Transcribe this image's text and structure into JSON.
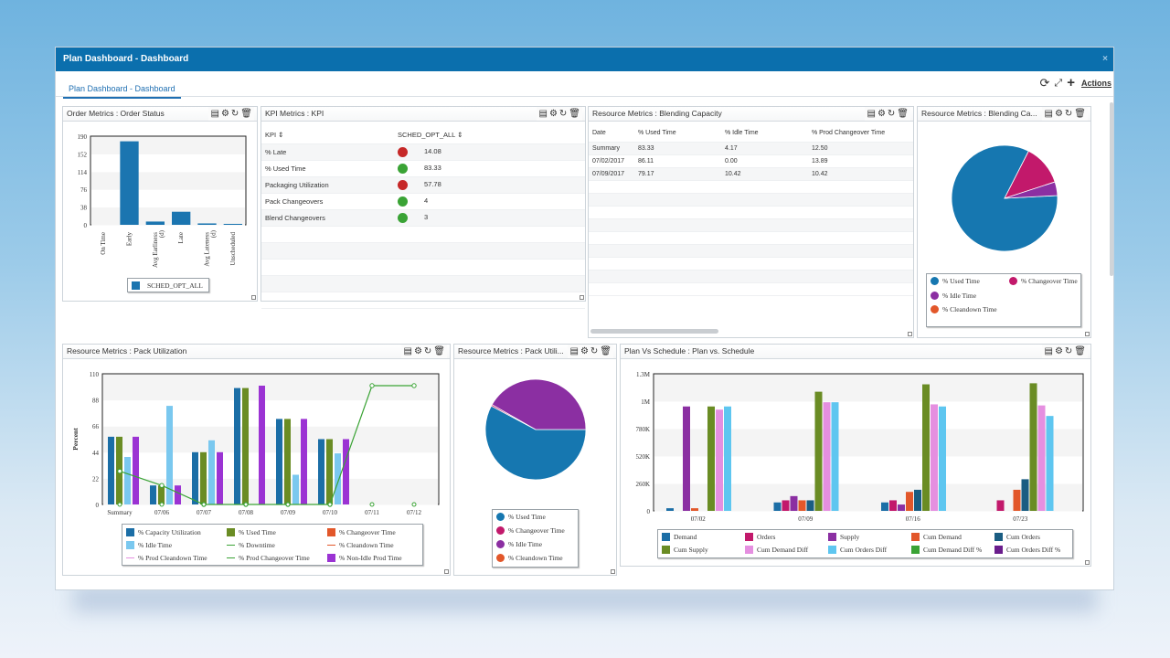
{
  "window": {
    "title": "Plan Dashboard - Dashboard",
    "tab": "Plan Dashboard - Dashboard",
    "actions_label": "Actions"
  },
  "panels": {
    "order": {
      "title": "Order Metrics : Order Status",
      "legend": "SCHED_OPT_ALL"
    },
    "kpi": {
      "title": "KPI Metrics : KPI",
      "col1": "KPI",
      "col2": "SCHED_OPT_ALL",
      "rows": [
        {
          "name": "% Late",
          "status": "red",
          "value": "14.08"
        },
        {
          "name": "% Used Time",
          "status": "green",
          "value": "83.33"
        },
        {
          "name": "Packaging Utilization",
          "status": "red",
          "value": "57.78"
        },
        {
          "name": "Pack Changeovers",
          "status": "green",
          "value": "4"
        },
        {
          "name": "Blend Changeovers",
          "status": "green",
          "value": "3"
        }
      ]
    },
    "resource": {
      "title": "Resource Metrics : Blending Capacity",
      "cols": [
        "Date",
        "% Used Time",
        "% Idle Time",
        "% Prod Changeover Time"
      ],
      "rows": [
        [
          "Summary",
          "83.33",
          "4.17",
          "12.50"
        ],
        [
          "07/02/2017",
          "86.11",
          "0.00",
          "13.89"
        ],
        [
          "07/09/2017",
          "79.17",
          "10.42",
          "10.42"
        ]
      ]
    },
    "blendpie": {
      "title": "Resource Metrics : Blending Ca..."
    },
    "pack": {
      "title": "Resource Metrics : Pack Utilization"
    },
    "packpie": {
      "title": "Resource Metrics : Pack Utili..."
    },
    "plan": {
      "title": "Plan Vs Schedule : Plan vs. Schedule"
    }
  },
  "colors": {
    "blue": "#1b75b0",
    "green": "#3aa335",
    "red": "#c62828",
    "pie_used": "#1677b0",
    "pie_changeover": "#c2196b",
    "pie_idle": "#8b2fa2",
    "cap": "#1b6ea6",
    "used": "#6a8c24",
    "chg": "#e2572a",
    "idle": "#7ac8ef",
    "nonidle": "#9b33d3",
    "line": "#3aa335",
    "demand": "#1b6ea6",
    "orders": "#c2196b",
    "supply": "#8b2fa2",
    "cumdemand": "#e2572a",
    "cumorders": "#1a5d82",
    "cumsupply": "#6a8c24",
    "cumdemanddiff": "#e58fe0",
    "cumordersdiff": "#5ec6f0",
    "cumdemanddiffpct": "#3aa335",
    "cumordersdiffpct": "#6a1d8c"
  },
  "chart_data": [
    {
      "type": "bar",
      "title": "Order Metrics : Order Status",
      "categories": [
        "On Time",
        "Early",
        "Avg Earliness (d)",
        "Late",
        "Avg Lateness (d)",
        "Unscheduled"
      ],
      "series": [
        {
          "name": "SCHED_OPT_ALL",
          "values": [
            0,
            179,
            7,
            28,
            3,
            2
          ]
        }
      ],
      "ylim": [
        0,
        190
      ],
      "yticks": [
        "190",
        "152",
        "114",
        "76",
        "38",
        "0"
      ]
    },
    {
      "type": "bar",
      "title": "Resource Metrics : Pack Utilization",
      "ylabel": "Percent",
      "ylim": [
        0,
        110
      ],
      "yticks": [
        "110",
        "88",
        "66",
        "44",
        "22",
        "0"
      ],
      "categories": [
        "Summary",
        "07/06",
        "07/07",
        "07/08",
        "07/09",
        "07/10",
        "07/11",
        "07/12"
      ],
      "series": [
        {
          "name": "% Capacity Utilization",
          "values": [
            57,
            16,
            44,
            98,
            72,
            55,
            0,
            0
          ]
        },
        {
          "name": "% Used Time",
          "values": [
            57,
            16,
            44,
            98,
            72,
            55,
            0,
            0
          ]
        },
        {
          "name": "% Changeover Time",
          "values": [
            0,
            0,
            0,
            0,
            0,
            0,
            0,
            0
          ]
        },
        {
          "name": "% Idle Time",
          "values": [
            40,
            83,
            54,
            0,
            25,
            43,
            0,
            0
          ]
        },
        {
          "name": "% Downtime",
          "values": [
            0,
            0,
            0,
            0,
            0,
            0,
            0,
            0
          ]
        },
        {
          "name": "% Cleandown Time",
          "values": [
            0,
            0,
            0,
            0,
            0,
            0,
            0,
            0
          ]
        },
        {
          "name": "% Prod Cleandown Time",
          "values": [
            0,
            0,
            0,
            0,
            0,
            0,
            0,
            0
          ]
        },
        {
          "name": "% Prod Changeover Time",
          "values": [
            28,
            16,
            0,
            0,
            0,
            0,
            100,
            100
          ]
        },
        {
          "name": "% Non-Idle Prod Time",
          "values": [
            57,
            16,
            44,
            100,
            72,
            55,
            0,
            0
          ]
        }
      ]
    },
    {
      "type": "bar",
      "title": "Plan Vs Schedule : Plan vs. Schedule",
      "ylim": [
        0,
        1300000
      ],
      "yticks": [
        "1.3M",
        "1M",
        "780K",
        "520K",
        "260K",
        "0"
      ],
      "categories": [
        "07/02",
        "07/09",
        "07/16",
        "07/23"
      ],
      "series": [
        {
          "name": "Demand",
          "values": [
            25000,
            80000,
            80000,
            0
          ]
        },
        {
          "name": "Orders",
          "values": [
            0,
            100000,
            100000,
            100000
          ]
        },
        {
          "name": "Supply",
          "values": [
            990000,
            140000,
            60000,
            0
          ]
        },
        {
          "name": "Cum Demand",
          "values": [
            25000,
            100000,
            180000,
            200000
          ]
        },
        {
          "name": "Cum Orders",
          "values": [
            0,
            100000,
            200000,
            300000
          ]
        },
        {
          "name": "Cum Supply",
          "values": [
            990000,
            1130000,
            1200000,
            1210000
          ]
        },
        {
          "name": "Cum Demand Diff",
          "values": [
            960000,
            1030000,
            1010000,
            1000000
          ]
        },
        {
          "name": "Cum Orders Diff",
          "values": [
            990000,
            1030000,
            990000,
            900000
          ]
        },
        {
          "name": "Cum Demand Diff %",
          "values": [
            0,
            0,
            0,
            0
          ]
        },
        {
          "name": "Cum Orders Diff %",
          "values": [
            0,
            0,
            0,
            0
          ]
        }
      ]
    },
    {
      "type": "pie",
      "title": "Resource Metrics : Blending Ca...",
      "slices": [
        {
          "name": "% Used Time",
          "value": 83.33
        },
        {
          "name": "% Changeover Time",
          "value": 12.5
        },
        {
          "name": "% Idle Time",
          "value": 4.17
        },
        {
          "name": "% Cleandown Time",
          "value": 0
        }
      ]
    },
    {
      "type": "pie",
      "title": "Resource Metrics : Pack Utili...",
      "slices": [
        {
          "name": "% Used Time",
          "value": 57.78
        },
        {
          "name": "% Changeover Time",
          "value": 0.5
        },
        {
          "name": "% Idle Time",
          "value": 41.72
        },
        {
          "name": "% Cleandown Time",
          "value": 0
        }
      ]
    }
  ]
}
